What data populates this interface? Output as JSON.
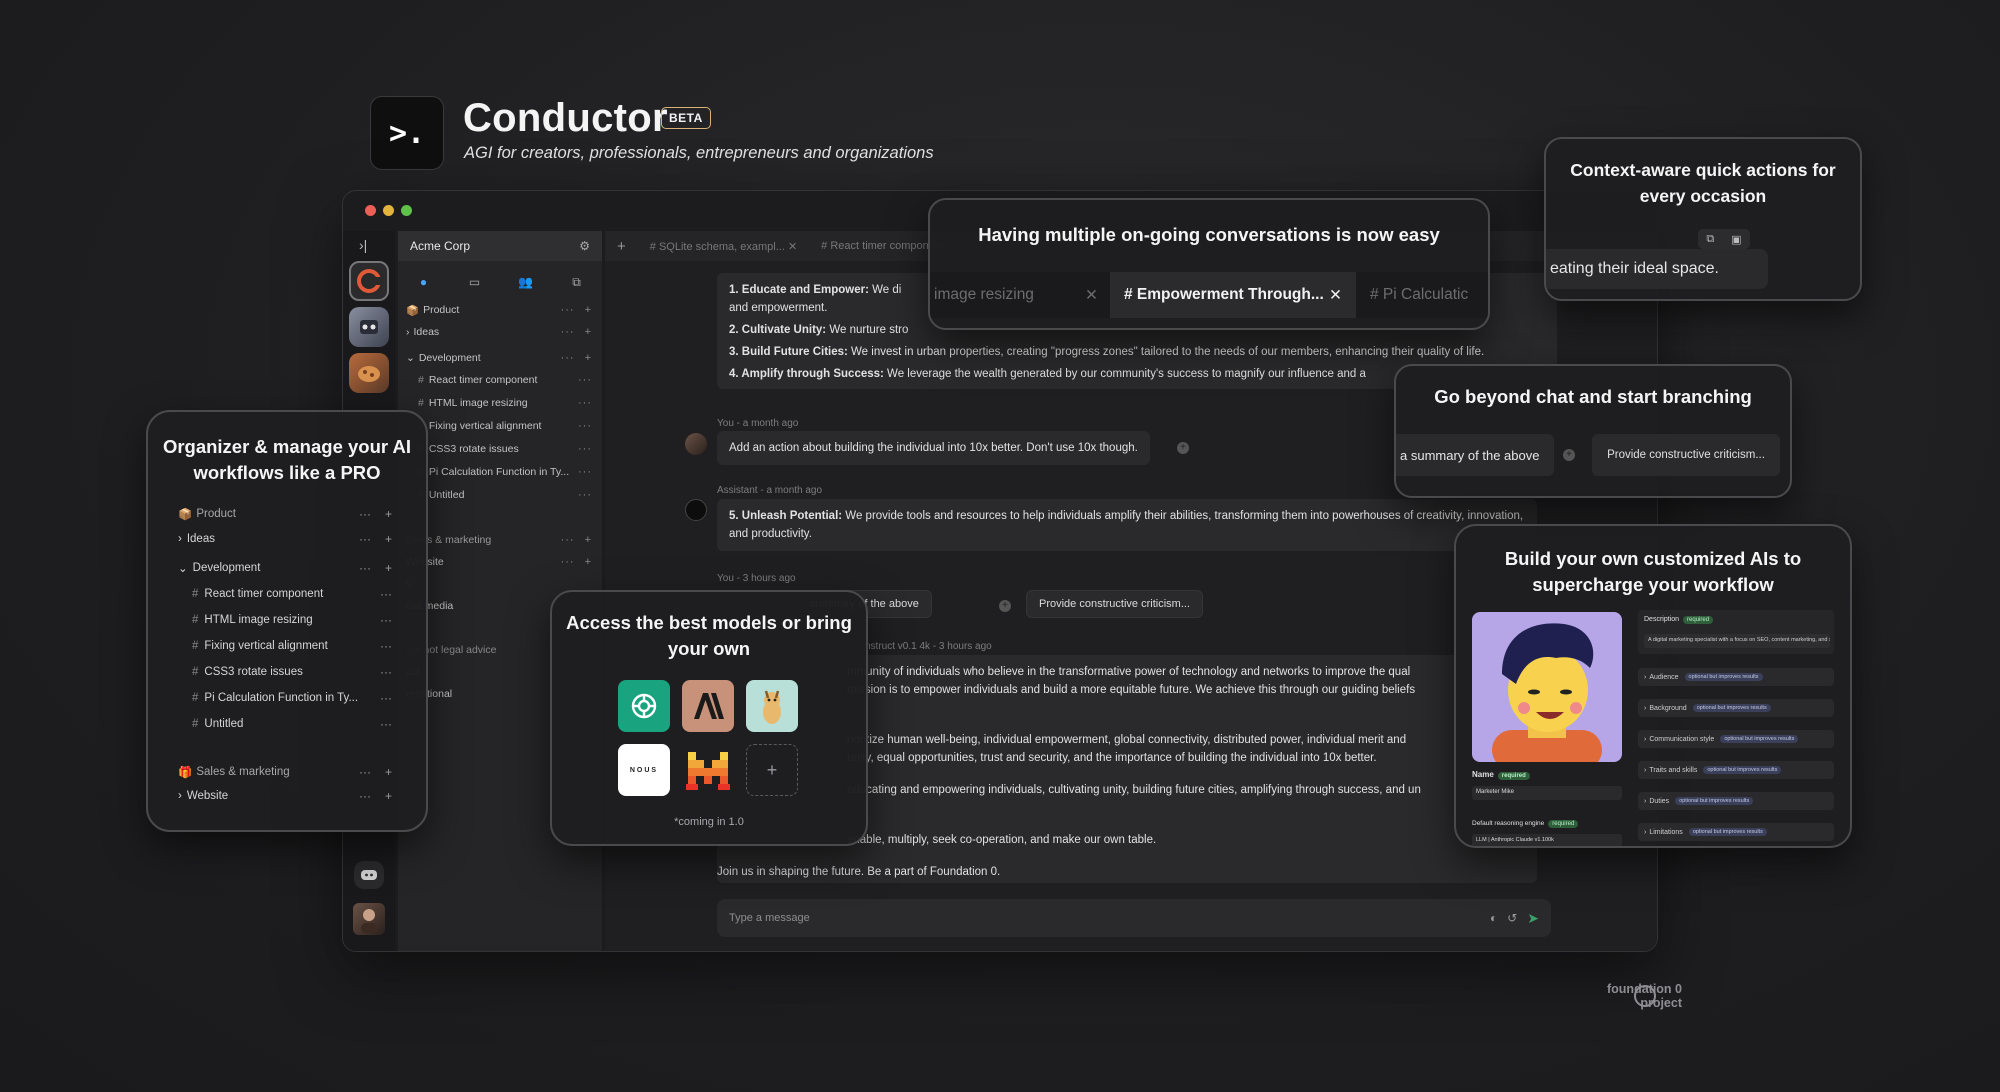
{
  "header": {
    "logo_glyph": ">.",
    "title": "Conductor",
    "badge": "BETA",
    "tagline": "AGI for creators, professionals, entrepreneurs and organizations"
  },
  "window": {
    "workspace": "Acme Corp",
    "tabs": [
      "# SQLite schema, exampl...",
      "# React timer component"
    ],
    "sidebar": {
      "product": "Product",
      "ideas": "Ideas",
      "development": "Development",
      "items": [
        "React timer component",
        "HTML image resizing",
        "Fixing vertical alignment",
        "CSS3 rotate issues",
        "Pi Calculation Function in Ty...",
        "Untitled"
      ],
      "sales": "Sales & marketing",
      "website": "Website",
      "partial": [
        "s",
        "cial media",
        "t of not legal advice",
        "cal",
        "ernational"
      ]
    },
    "messages": {
      "list_items": [
        {
          "bold": "1. Educate and Empower:",
          "text": " We di"
        },
        {
          "bold": "",
          "text": "and empowerment."
        },
        {
          "bold": "2. Cultivate Unity:",
          "text": " We nurture stro"
        },
        {
          "bold": "3. Build Future Cities:",
          "text": " We invest in urban properties, creating \"progress zones\" tailored to the needs of our members, enhancing their quality of life."
        },
        {
          "bold": "4. Amplify through Success:",
          "text": " We leverage the wealth generated by our community's success to magnify our influence and a"
        }
      ],
      "user_meta_1": "You - a month ago",
      "user_msg_1": "Add an action about building the individual into 10x better. Don't use 10x though.",
      "assistant_meta_1": "Assistant - a month ago",
      "assistant_bold": "5. Unleash Potential:",
      "assistant_text": " We provide tools and resources to help individuals amplify their abilities, transforming them into powerhouses of creativity, innovation, and productivity.",
      "user_meta_2": "You - 3 hours ago",
      "user_msg_2": "summary of the above",
      "user_branch_2": "Provide constructive criticism...",
      "assistant_meta_2": "nstruct v0.1 4k - 3 hours ago",
      "body_lines": [
        "mmunity of individuals who believe in the transformative power of technology and networks to improve the qual",
        "mission is to empower individuals and build a more equitable future. We achieve this through our guiding beliefs",
        "",
        "rioritize human well-being, individual empowerment, global connectivity, distributed power, individual merit and",
        "unity, equal opportunities, trust and security, and the importance of building the individual into 10x better.",
        "",
        "educating and empowering individuals, cultivating unity, building future cities, amplifying through success, and un",
        "",
        "",
        "enable, multiply, seek co-operation, and make our own table."
      ],
      "closing": "Join us in shaping the future. Be a part of Foundation 0."
    },
    "composer_placeholder": "Type a message"
  },
  "cards": {
    "conversations": {
      "title": "Having multiple on-going conversations is now easy",
      "tabs": [
        "image resizing",
        "# Empowerment Through...",
        "# Pi Calculatic"
      ]
    },
    "quick_actions": {
      "title": "Context-aware quick actions for every occasion",
      "snippet": "eating their ideal space."
    },
    "branching": {
      "title": "Go beyond chat and start branching",
      "left": "a summary of the above",
      "right": "Provide constructive criticism..."
    },
    "organizer": {
      "title": "Organizer & manage your AI workflows like a PRO",
      "product": "Product",
      "ideas": "Ideas",
      "development": "Development",
      "items": [
        "React timer component",
        "HTML image resizing",
        "Fixing vertical alignment",
        "CSS3 rotate issues",
        "Pi Calculation Function in Ty...",
        "Untitled"
      ],
      "sales": "Sales & marketing",
      "website": "Website"
    },
    "models": {
      "title": "Access the best models or bring your own",
      "nous_label": "NOUS",
      "note": "*coming in 1.0"
    },
    "custom_ai": {
      "title": "Build your own customized AIs to supercharge your workflow",
      "description_label": "Description",
      "required": "required",
      "description_text": "A digital marketing specialist with a focus on SEO, content marketing, and socia",
      "name_label": "Name",
      "name_value": "Marketer Mike",
      "engine_label": "Default reasoning engine",
      "engine_value": "LLM | Anthropic Claude v1.100k",
      "optional": "optional but improves results",
      "fields": [
        "Audience",
        "Background",
        "Communication style",
        "Traits and skills",
        "Duties",
        "Limitations"
      ]
    }
  },
  "footer": {
    "line1": "foundation 0",
    "line2": "project"
  },
  "colors": {
    "accent_green": "#3aa06a",
    "badge_border": "#d9b27a",
    "bg": "#1e1e20"
  }
}
